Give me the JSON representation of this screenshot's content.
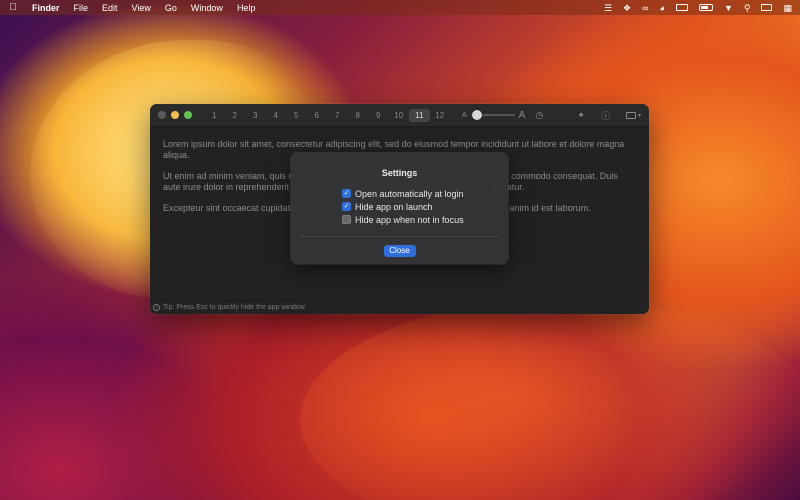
{
  "menubar": {
    "app_name": "Finder",
    "items": [
      "File",
      "Edit",
      "View",
      "Go",
      "Window",
      "Help"
    ]
  },
  "window": {
    "tabs": [
      "1",
      "2",
      "3",
      "4",
      "5",
      "6",
      "7",
      "8",
      "9",
      "10",
      "11",
      "12"
    ],
    "active_tab": "11",
    "font_small_glyph": "A",
    "font_large_glyph": "A",
    "font_size_level": 0.15,
    "editor_paragraphs": [
      "Lorem ipsum dolor sit amet, consectetur adipiscing elit, sed do eiusmod tempor incididunt ut labore et dolore magna aliqua.",
      "Ut enim ad minim veniam, quis nostrud exercitation ullamco laboris nisi ut aliquip ex ea commodo consequat. Duis aute irure dolor in reprehenderit in voluptate velit esse cillum dolore eu fugiat nulla pariatur.",
      "Excepteur sint occaecat cupidatat non proident, sunt in culpa qui officia deserunt mollit anim id est laborum."
    ],
    "status_tip": "Tip: Press Esc to quickly hide the app window."
  },
  "settings": {
    "title": "Settings",
    "options": [
      {
        "label": "Open automatically at login",
        "checked": true
      },
      {
        "label": "Hide app on launch",
        "checked": true
      },
      {
        "label": "Hide app when not in focus",
        "checked": false
      }
    ],
    "close_label": "Close"
  },
  "colors": {
    "accent": "#2f6fdb",
    "traffic_yellow": "#f4bf4f",
    "traffic_green": "#61c554"
  },
  "icons": {
    "menubar_status": [
      "list-icon",
      "dropbox-icon",
      "creative-cloud-icon",
      "eye-icon",
      "keyboard-icon",
      "battery-icon",
      "wifi-icon",
      "search-icon",
      "screen-mirroring-icon",
      "control-center-icon"
    ]
  }
}
